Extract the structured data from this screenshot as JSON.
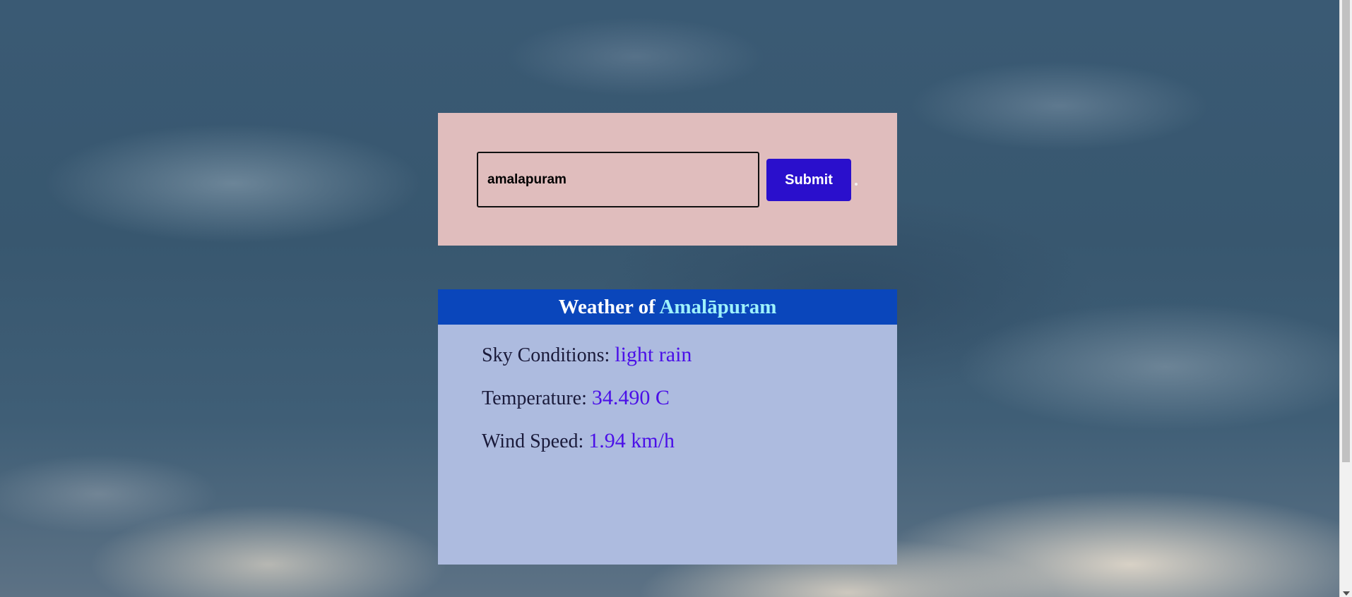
{
  "search": {
    "value": "amalapuram",
    "submit_label": "Submit"
  },
  "weather": {
    "heading_prefix": "Weather of ",
    "city": "Amalāpuram",
    "rows": [
      {
        "label": "Sky Conditions: ",
        "value": "light rain"
      },
      {
        "label": "Temperature: ",
        "value": "34.490 C"
      },
      {
        "label": "Wind Speed: ",
        "value": "1.94 km/h"
      }
    ]
  },
  "colors": {
    "search_panel_bg": "#e0bdbd",
    "submit_bg": "#2a0fcc",
    "card_header_bg": "#0a46bb",
    "card_bg": "#adbbdf",
    "city_text": "#9ef2fb",
    "value_text": "#4b10e8"
  }
}
